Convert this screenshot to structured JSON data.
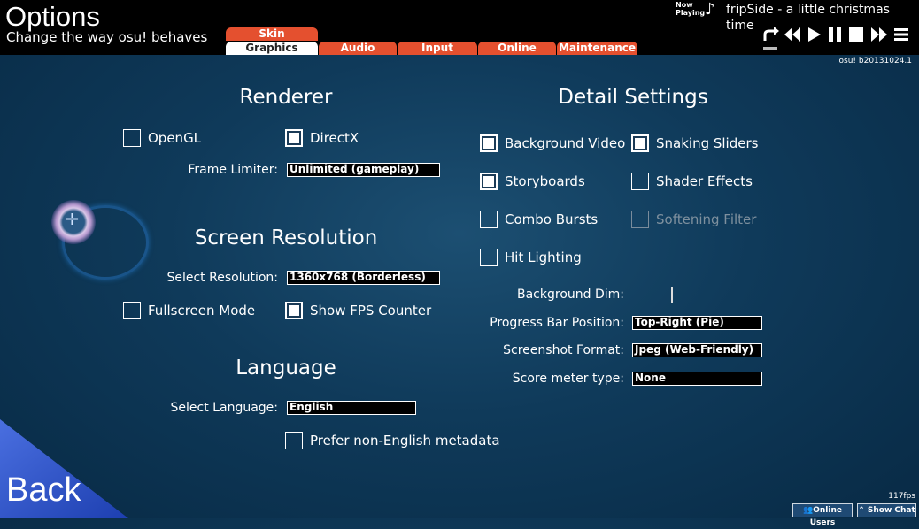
{
  "header": {
    "title": "Options",
    "subtitle": "Change the way osu! behaves",
    "tabs_top": [
      "Skin"
    ],
    "tabs": [
      "Graphics",
      "Audio",
      "Input",
      "Online",
      "Maintenance"
    ],
    "active_tab": "Graphics",
    "version": "osu! b20131024.1"
  },
  "now_playing": {
    "label_line1": "Now",
    "label_line2": "Playing",
    "note": "♪",
    "song": "fripSide - a little christmas time",
    "controls": [
      "random-icon",
      "previous-icon",
      "play-icon",
      "pause-icon",
      "stop-icon",
      "next-icon",
      "menu-icon"
    ]
  },
  "renderer": {
    "title": "Renderer",
    "opengl": {
      "label": "OpenGL",
      "checked": false
    },
    "directx": {
      "label": "DirectX",
      "checked": true
    },
    "frame_limiter": {
      "label": "Frame Limiter:",
      "value": "Unlimited (gameplay)"
    }
  },
  "resolution": {
    "title": "Screen Resolution",
    "select": {
      "label": "Select Resolution:",
      "value": "1360x768 (Borderless)"
    },
    "fullscreen": {
      "label": "Fullscreen Mode",
      "checked": false
    },
    "fps_counter": {
      "label": "Show FPS Counter",
      "checked": true
    }
  },
  "language": {
    "title": "Language",
    "select": {
      "label": "Select Language:",
      "value": "English"
    },
    "prefer_non_english": {
      "label": "Prefer non-English metadata",
      "checked": false
    }
  },
  "detail": {
    "title": "Detail Settings",
    "checkboxes": [
      {
        "label": "Background Video",
        "checked": true,
        "enabled": true
      },
      {
        "label": "Snaking Sliders",
        "checked": true,
        "enabled": true
      },
      {
        "label": "Storyboards",
        "checked": true,
        "enabled": true
      },
      {
        "label": "Shader Effects",
        "checked": false,
        "enabled": true
      },
      {
        "label": "Combo Bursts",
        "checked": false,
        "enabled": true
      },
      {
        "label": "Softening Filter",
        "checked": false,
        "enabled": false
      },
      {
        "label": "Hit Lighting",
        "checked": false,
        "enabled": true
      }
    ],
    "background_dim": {
      "label": "Background Dim:",
      "value": 0.3
    },
    "progress_bar": {
      "label": "Progress Bar Position:",
      "value": "Top-Right (Pie)"
    },
    "screenshot_format": {
      "label": "Screenshot Format:",
      "value": "Jpeg (Web-Friendly)"
    },
    "score_meter": {
      "label": "Score meter type:",
      "value": "None"
    }
  },
  "footer": {
    "back": "Back",
    "fps": "117fps",
    "online_users": "Online Users",
    "show_chat": "Show Chat"
  },
  "colors": {
    "tab_accent": "#e4502f",
    "background": "#0f3a5a"
  }
}
